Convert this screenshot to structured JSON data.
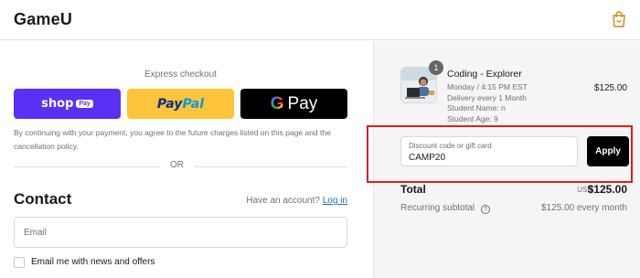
{
  "header": {
    "brand": "GameU",
    "cart_icon": "shopping-bag-icon"
  },
  "express": {
    "title": "Express checkout",
    "shop_pay": {
      "label": "shop",
      "chip": "Pay",
      "color": "#5a31f4"
    },
    "paypal": {
      "part1": "Pay",
      "part2": "Pal",
      "color": "#ffc439"
    },
    "gpay": {
      "g": "G",
      "label": "Pay",
      "color": "#000000"
    },
    "disclaimer": "By continuing with your payment, you agree to the future charges listed on this page and the cancellation policy.",
    "divider": "OR"
  },
  "contact": {
    "title": "Contact",
    "account_prompt": "Have an account?",
    "login_label": "Log in",
    "email_placeholder": "Email",
    "email_value": "",
    "newsletter_label": "Email me with news and offers",
    "newsletter_checked": false
  },
  "order": {
    "item": {
      "quantity": "1",
      "title": "Coding - Explorer",
      "schedule": "Monday / 4:15 PM EST",
      "delivery": "Delivery every 1 Month",
      "student_name": "Student Name: n",
      "student_age": "Student Age: 9",
      "price": "$125.00"
    },
    "discount": {
      "placeholder": "Discount code or gift card",
      "value": "CAMP20",
      "apply_label": "Apply"
    },
    "total": {
      "label": "Total",
      "currency": "USD",
      "amount": "$125.00"
    },
    "recurring": {
      "label": "Recurring subtotal",
      "value": "$125.00 every month"
    }
  },
  "colors": {
    "accent_link": "#1773b0",
    "highlight": "#e01e1e",
    "summary_bg": "#f5f5f5"
  }
}
